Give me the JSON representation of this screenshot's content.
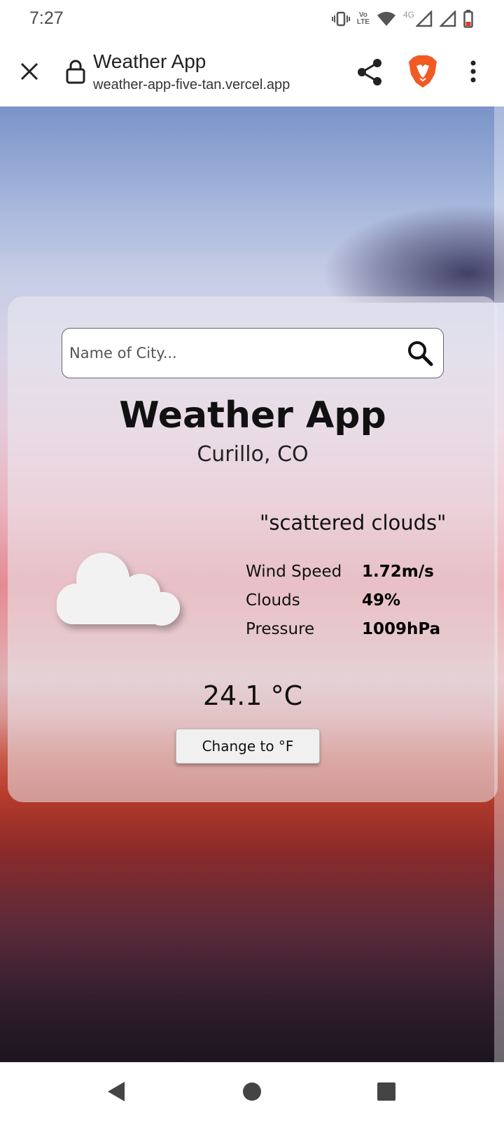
{
  "status_bar": {
    "time": "7:27",
    "volte_top": "Vo",
    "volte_bottom": "LTE",
    "network": "4G",
    "icons": [
      "vibrate-icon",
      "volte-icon",
      "wifi-icon",
      "signal-icon",
      "signal-icon",
      "battery-icon"
    ]
  },
  "browser": {
    "page_title": "Weather App",
    "url": "weather-app-five-tan.vercel.app",
    "icons": [
      "close-icon",
      "lock-icon",
      "share-icon",
      "brave-lion-icon",
      "more-vert-icon"
    ],
    "brave_color": "#f25a24"
  },
  "weather": {
    "search_placeholder": "Name of City...",
    "search_value": "",
    "app_title": "Weather App",
    "location": "Curillo, CO",
    "description": "\"scattered clouds\"",
    "condition_icon": "cloud-icon",
    "stats": [
      {
        "label": "Wind Speed",
        "value": "1.72m/s"
      },
      {
        "label": "Clouds",
        "value": "49%"
      },
      {
        "label": "Pressure",
        "value": "1009hPa"
      }
    ],
    "temperature": "24.1 °C",
    "toggle_label": "Change to °F"
  },
  "nav_bar": {
    "icons": [
      "back-icon",
      "home-icon",
      "recents-icon"
    ]
  }
}
